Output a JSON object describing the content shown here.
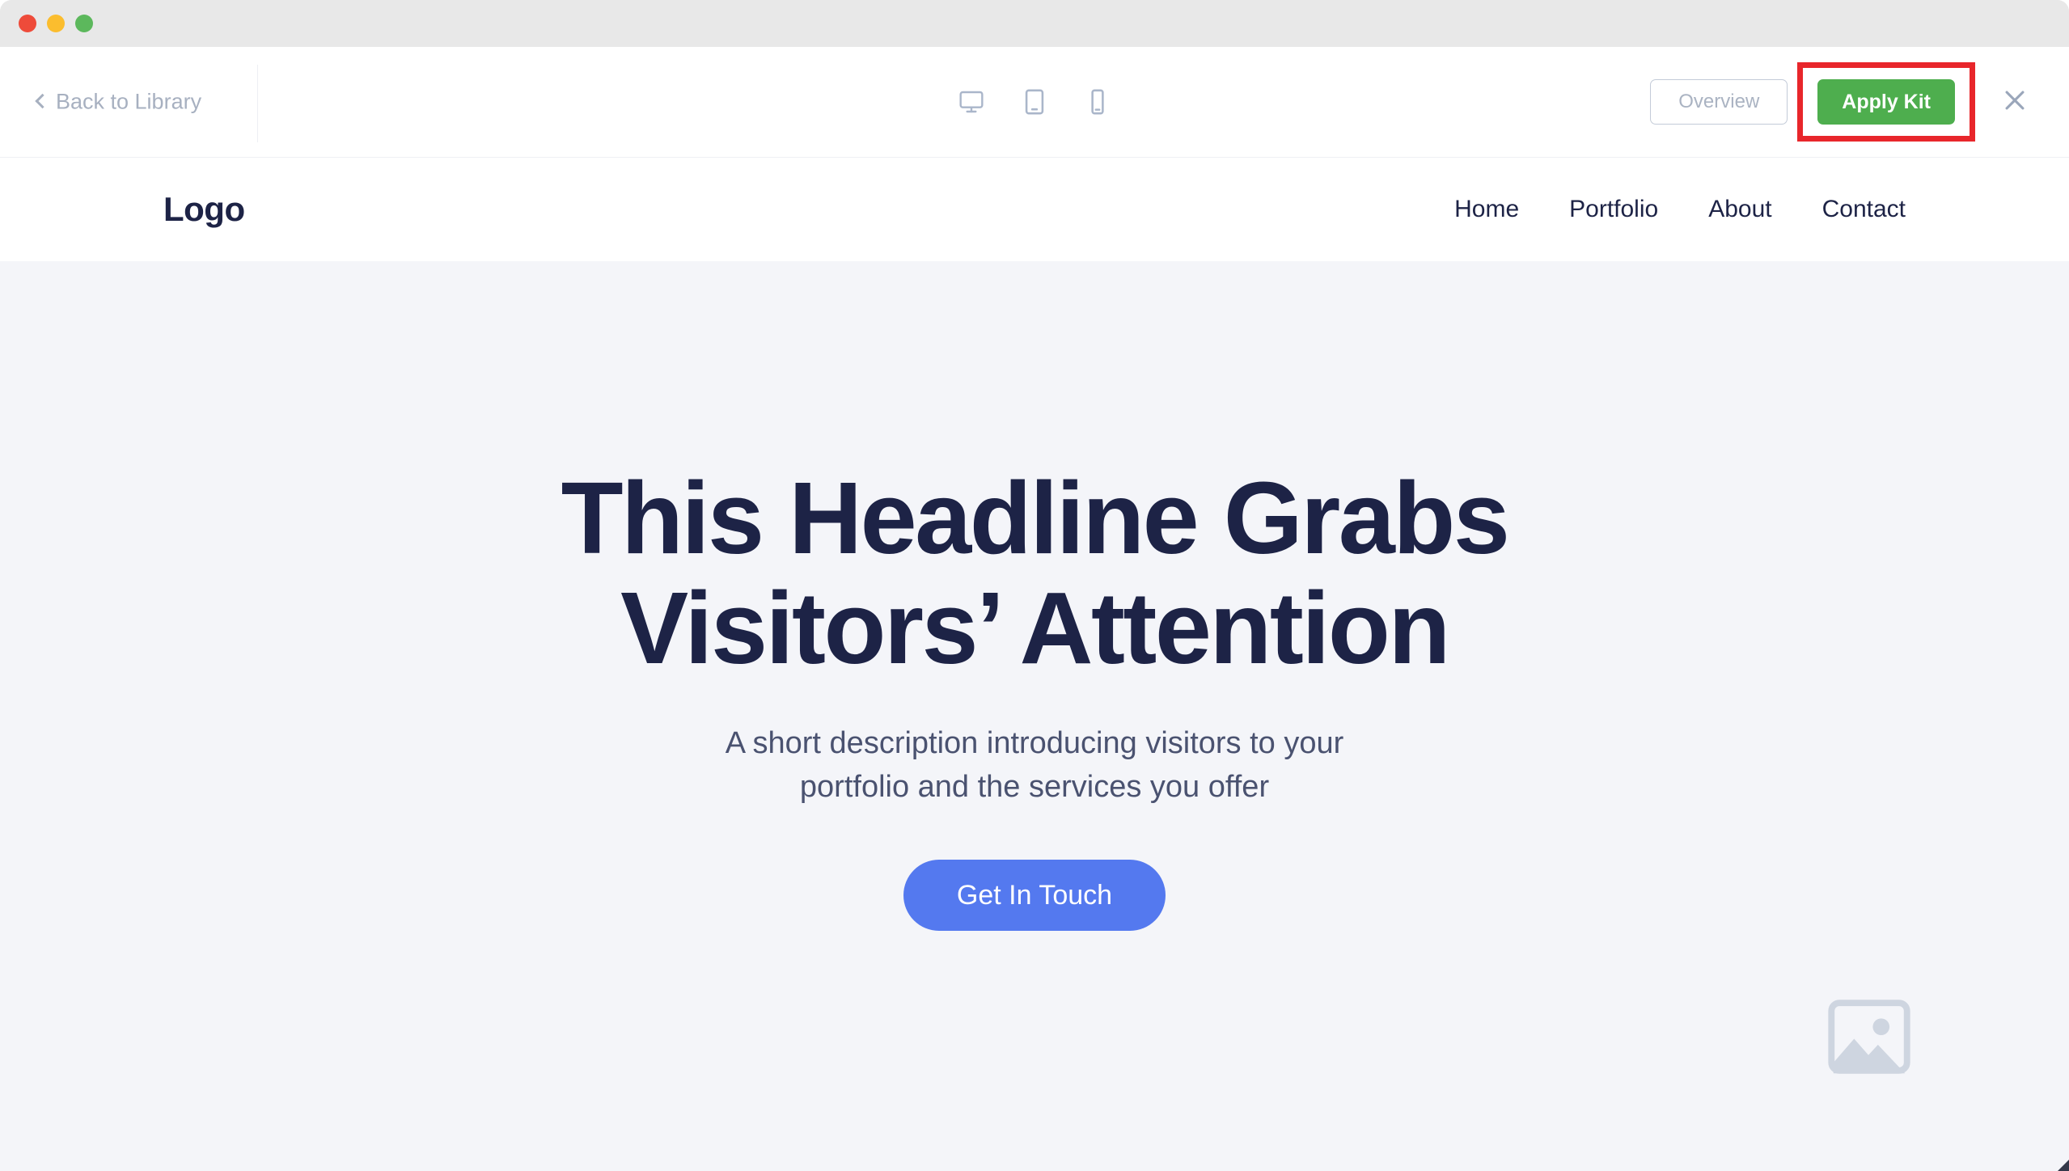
{
  "window": {
    "traffic_lights": [
      {
        "name": "close",
        "color": "#ee4b3a"
      },
      {
        "name": "minimize",
        "color": "#fbbd2e"
      },
      {
        "name": "zoom",
        "color": "#5cb85c"
      }
    ]
  },
  "toolbar": {
    "back_label": "Back to Library",
    "devices": [
      {
        "id": "desktop",
        "icon": "monitor-icon",
        "active": true
      },
      {
        "id": "tablet",
        "icon": "tablet-icon",
        "active": false
      },
      {
        "id": "mobile",
        "icon": "mobile-icon",
        "active": false
      }
    ],
    "overview_label": "Overview",
    "apply_label": "Apply Kit",
    "close_label": "Close",
    "highlight_color": "#e8262b",
    "apply_color": "#4eae4e"
  },
  "site": {
    "logo": "Logo",
    "nav": [
      {
        "label": "Home"
      },
      {
        "label": "Portfolio"
      },
      {
        "label": "About"
      },
      {
        "label": "Contact"
      }
    ],
    "hero": {
      "title_line1": "This Headline Grabs",
      "title_line2": "Visitors’ Attention",
      "subtitle_line1": "A short description introducing visitors to your",
      "subtitle_line2": "portfolio and the services you offer",
      "cta_label": "Get In Touch",
      "image_placeholder_icon": "image-placeholder-icon",
      "background_color": "#f4f5f9",
      "text_color": "#1d2346",
      "cta_color": "#5479ef"
    }
  }
}
